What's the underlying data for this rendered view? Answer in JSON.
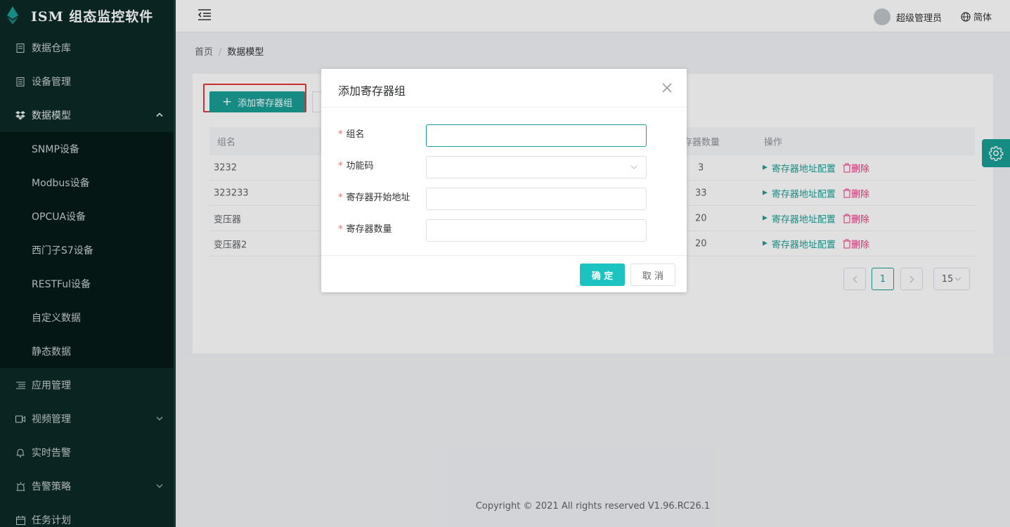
{
  "app": {
    "title": "ISM 组态监控软件"
  },
  "colors": {
    "accent": "#1a9f97",
    "sidebar_bg": "#0b2a26",
    "danger": "#e4397a",
    "highlight": "#e53935"
  },
  "sidebar": {
    "items": [
      {
        "label": "数据仓库",
        "icon": "file-icon"
      },
      {
        "label": "设备管理",
        "icon": "device-icon"
      },
      {
        "label": "数据模型",
        "icon": "dropbox-icon",
        "expanded": true,
        "children": [
          "SNMP设备",
          "Modbus设备",
          "OPCUA设备",
          "西门子S7设备",
          "RESTFul设备",
          "自定义数据",
          "静态数据"
        ]
      },
      {
        "label": "应用管理",
        "icon": "list-icon"
      },
      {
        "label": "视频管理",
        "icon": "video-icon",
        "has_arrow": true
      },
      {
        "label": "实时告警",
        "icon": "bell-icon"
      },
      {
        "label": "告警策略",
        "icon": "alarm-icon",
        "has_arrow": true
      },
      {
        "label": "任务计划",
        "icon": "calendar-icon"
      }
    ]
  },
  "header": {
    "user": "超级管理员",
    "lang": "简体"
  },
  "breadcrumb": {
    "home": "首页",
    "sep": "/",
    "current": "数据模型"
  },
  "toolbar": {
    "add_label": "添加寄存器组"
  },
  "table": {
    "columns": {
      "name": "组名",
      "count": "寄存器数量",
      "count_visible": "存器数量",
      "ops": "操作"
    },
    "rows": [
      {
        "name": "3232",
        "count": "3"
      },
      {
        "name": "323233",
        "count": "33"
      },
      {
        "name": "变压器",
        "count": "20"
      },
      {
        "name": "变压器2",
        "count": "20"
      }
    ],
    "op_config": "寄存器地址配置",
    "op_delete": "删除"
  },
  "pagination": {
    "current": "1",
    "page_size": "15"
  },
  "footer": {
    "copyright": "Copyright © 2021 All rights reserved V1.96.RC26.1"
  },
  "dialog": {
    "title": "添加寄存器组",
    "fields": [
      {
        "label": "组名",
        "value": "",
        "type": "text"
      },
      {
        "label": "功能码",
        "value": "",
        "type": "select"
      },
      {
        "label": "寄存器开始地址",
        "value": "",
        "type": "text"
      },
      {
        "label": "寄存器数量",
        "value": "",
        "type": "text"
      }
    ],
    "ok_label": "确 定",
    "cancel_label": "取 消"
  }
}
